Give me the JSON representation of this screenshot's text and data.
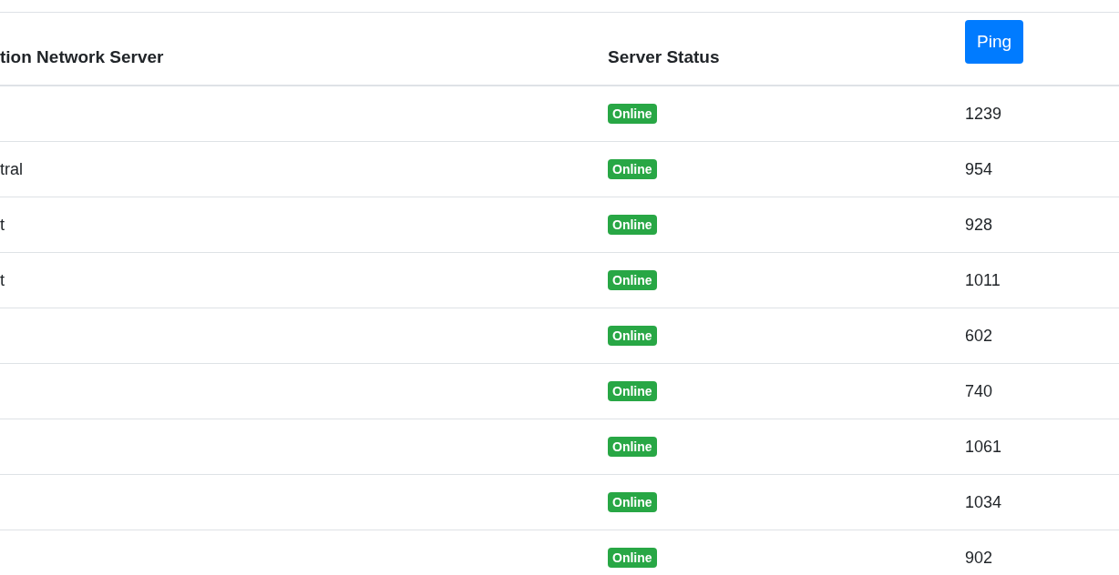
{
  "table": {
    "columns": [
      {
        "label": "tion Network Server",
        "kind": "text"
      },
      {
        "label": "Server Status",
        "kind": "text"
      },
      {
        "label": "Ping",
        "kind": "button"
      }
    ],
    "rows": [
      {
        "name": "",
        "status": "Online",
        "ping": "1239"
      },
      {
        "name": "tral",
        "status": "Online",
        "ping": "954"
      },
      {
        "name": "t",
        "status": "Online",
        "ping": "928"
      },
      {
        "name": "t",
        "status": "Online",
        "ping": "1011"
      },
      {
        "name": "",
        "status": "Online",
        "ping": "602"
      },
      {
        "name": "",
        "status": "Online",
        "ping": "740"
      },
      {
        "name": "",
        "status": "Online",
        "ping": "1061"
      },
      {
        "name": "",
        "status": "Online",
        "ping": "1034"
      },
      {
        "name": "",
        "status": "Online",
        "ping": "902"
      }
    ]
  }
}
